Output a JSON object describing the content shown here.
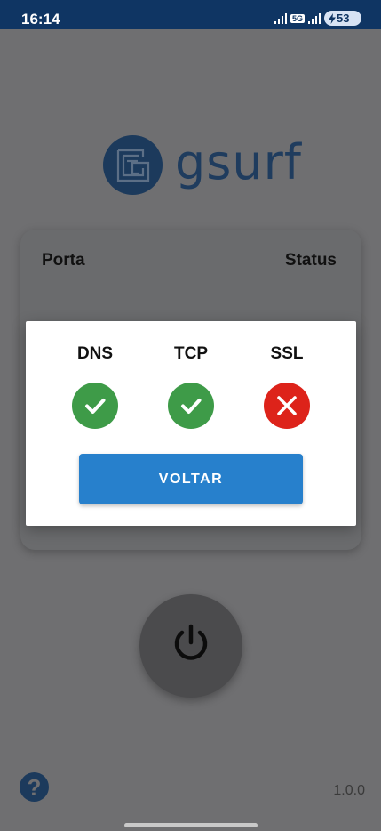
{
  "status_bar": {
    "time": "16:14",
    "network_label": "5G",
    "battery": "53"
  },
  "brand": {
    "name": "gsurf"
  },
  "card": {
    "col_port": "Porta",
    "col_status": "Status"
  },
  "dialog": {
    "checks": [
      {
        "label": "DNS",
        "state": "ok",
        "icon": "check-icon"
      },
      {
        "label": "TCP",
        "state": "ok",
        "icon": "check-icon"
      },
      {
        "label": "SSL",
        "state": "error",
        "icon": "close-icon"
      }
    ],
    "back_button": "VOLTAR"
  },
  "footer": {
    "help_symbol": "?",
    "version": "1.0.0"
  },
  "colors": {
    "status_bar": "#0f3563",
    "success": "#3e9b48",
    "error": "#dd231a",
    "primary_button": "#2780cc"
  }
}
